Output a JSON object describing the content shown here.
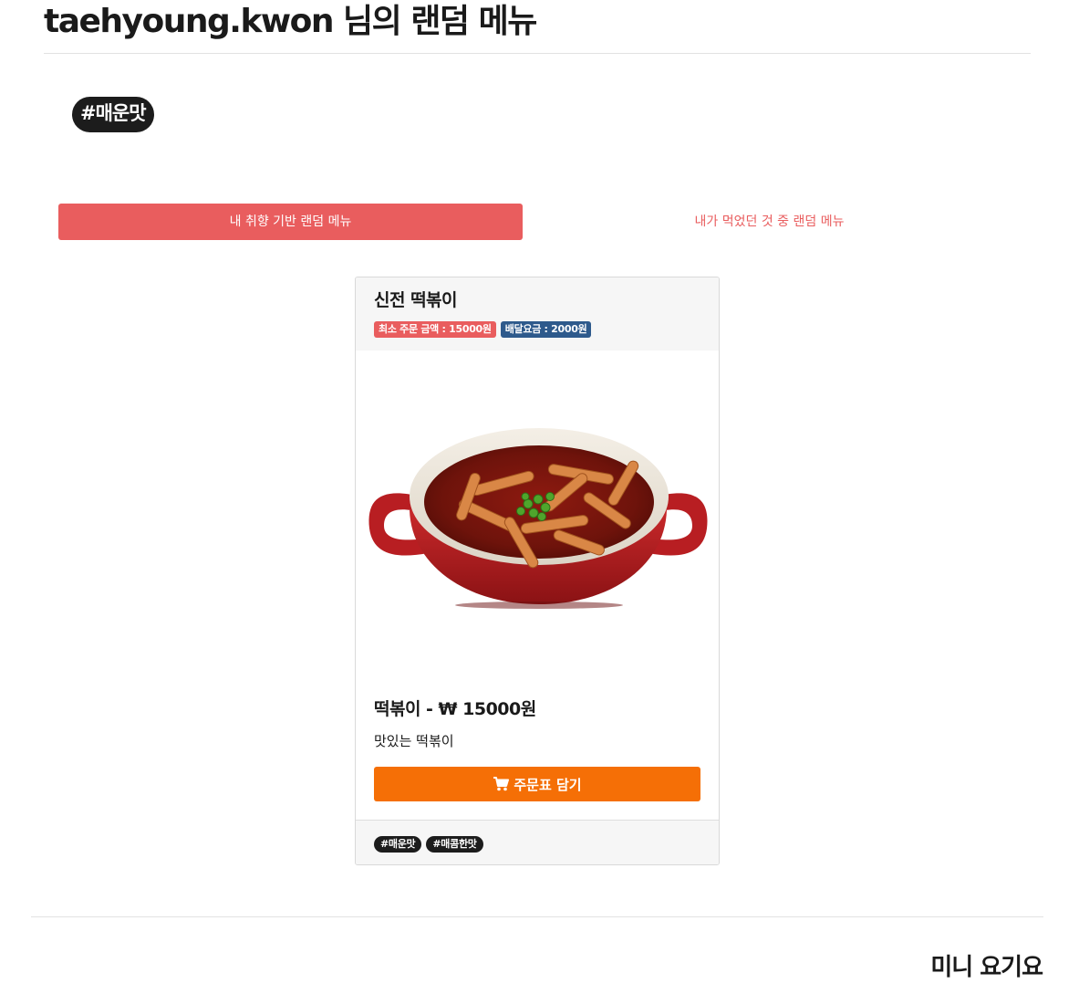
{
  "page": {
    "title": "taehyoung.kwon 님의 랜덤 메뉴"
  },
  "taste_tag": "#매운맛",
  "tabs": [
    {
      "label": "내 취향 기반 랜덤 메뉴",
      "active": true
    },
    {
      "label": "내가 먹었던 것 중 랜덤 메뉴",
      "active": false
    }
  ],
  "card": {
    "store_name": "신전 떡볶이",
    "min_order_badge": "최소 주문 금액 : 15000원",
    "delivery_fee_badge": "배달요금 : 2000원",
    "image": "tteokbokki-dish-image",
    "menu_title": "떡볶이 - ₩ 15000원",
    "menu_description": "맛있는 떡볶이",
    "order_button": {
      "icon": "cart-icon",
      "label": "주문표 담기"
    },
    "tags": [
      "#매운맛",
      "#매콤한맛"
    ]
  },
  "footer": {
    "brand": "미니 요기요"
  },
  "colors": {
    "accent_red": "#e95d5e",
    "badge_blue": "#2e5a8c",
    "order_orange": "#f56f06",
    "tag_black": "#1c1c1c"
  }
}
